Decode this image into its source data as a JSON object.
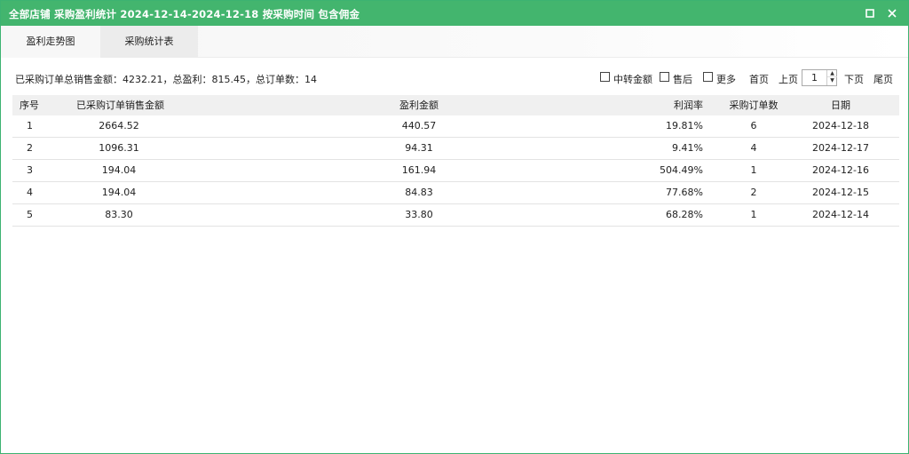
{
  "window": {
    "title": "全部店铺 采购盈利统计 2024-12-14-2024-12-18 按采购时间 包含佣金",
    "buttons": [
      "maximize-icon",
      "close-icon"
    ],
    "accent_color": "#43b56e"
  },
  "tabs": [
    {
      "label": "盈利走势图",
      "active": false
    },
    {
      "label": "采购统计表",
      "active": true
    }
  ],
  "summary": "已采购订单总销售金额：4232.21，总盈利：815.45，总订单数：14",
  "filters": {
    "zhongzhuan_label": "中转金额",
    "shouhou_label": "售后",
    "more_label": "更多"
  },
  "pagination": {
    "first": "首页",
    "prev": "上页",
    "current_page": "1",
    "next": "下页",
    "last": "尾页"
  },
  "table": {
    "columns": [
      "序号",
      "已采购订单销售金额",
      "盈利金额",
      "利润率",
      "采购订单数",
      "日期"
    ],
    "rows": [
      {
        "no": "1",
        "sales": "2664.52",
        "profit": "440.57",
        "rate": "19.81%",
        "orders": "6",
        "date": "2024-12-18"
      },
      {
        "no": "2",
        "sales": "1096.31",
        "profit": "94.31",
        "rate": "9.41%",
        "orders": "4",
        "date": "2024-12-17"
      },
      {
        "no": "3",
        "sales": "194.04",
        "profit": "161.94",
        "rate": "504.49%",
        "orders": "1",
        "date": "2024-12-16"
      },
      {
        "no": "4",
        "sales": "194.04",
        "profit": "84.83",
        "rate": "77.68%",
        "orders": "2",
        "date": "2024-12-15"
      },
      {
        "no": "5",
        "sales": "83.30",
        "profit": "33.80",
        "rate": "68.28%",
        "orders": "1",
        "date": "2024-12-14"
      }
    ]
  }
}
